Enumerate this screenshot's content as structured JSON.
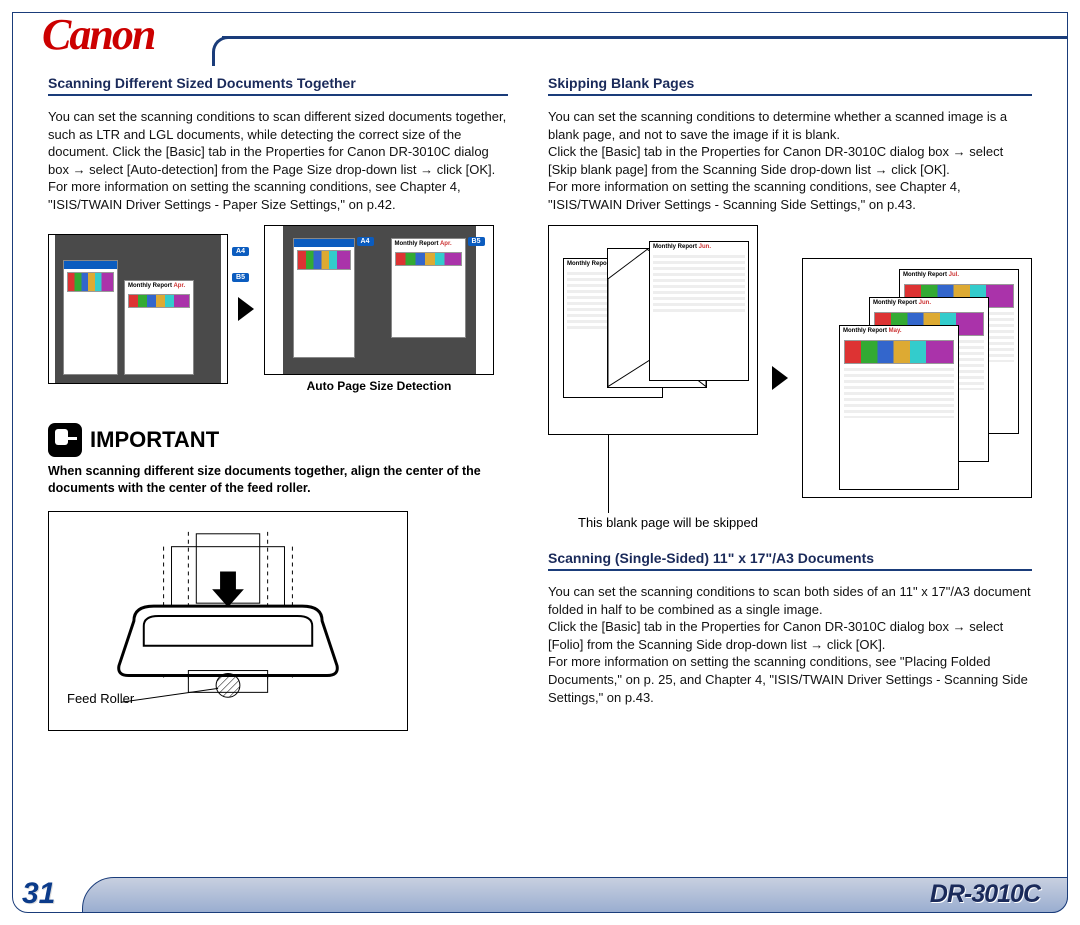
{
  "brand": "Canon",
  "page_number": "31",
  "model": "DR-3010C",
  "left": {
    "heading1": "Scanning Different Sized Documents Together",
    "para1": "You can set the scanning conditions to scan different sized documents together, such as LTR and LGL documents, while detecting the correct size of the document. Click the [Basic] tab in the Properties for Canon DR-3010C dialog box → select [Auto-detection] from the Page Size drop-down list → click [OK].\nFor more information on setting the scanning conditions, see Chapter 4, \"ISIS/TWAIN Driver Settings - Paper Size Settings,\" on p.42.",
    "caption1": "Auto Page Size Detection",
    "badges": {
      "a4": "A4",
      "b5": "B5"
    },
    "report": {
      "title": "Monthly Report",
      "month": "Apr."
    },
    "important_label": "IMPORTANT",
    "important_note": "When scanning different size documents together, align the center of the documents with the center of the feed roller.",
    "feed_label": "Feed Roller"
  },
  "right": {
    "heading1": "Skipping Blank Pages",
    "para1": "You can set the scanning conditions to determine whether a scanned image is a blank page, and not to save the image if it is blank.\nClick the [Basic] tab in the Properties for Canon DR-3010C dialog box → select [Skip blank page] from the Scanning Side drop-down list → click [OK].\nFor more information on setting the scanning conditions, see Chapter 4, \"ISIS/TWAIN Driver Settings - Scanning Side Settings,\" on p.43.",
    "skip_caption": "This blank page will be skipped",
    "reports": {
      "title": "Monthly Report",
      "months": {
        "may": "May.",
        "jun": "Jun.",
        "jul": "Jul."
      }
    },
    "heading2": "Scanning (Single-Sided) 11\" x 17\"/A3 Documents",
    "para2": "You can set the scanning conditions to scan both sides of an 11\" x 17\"/A3 document folded in half to be combined as a single image.\nClick the [Basic] tab in the Properties for Canon DR-3010C dialog box → select [Folio] from the Scanning Side drop-down list → click [OK].\nFor more information on setting the scanning conditions, see \"Placing Folded Documents,\" on p. 25, and Chapter 4, \"ISIS/TWAIN Driver Settings - Scanning Side Settings,\" on p.43."
  }
}
